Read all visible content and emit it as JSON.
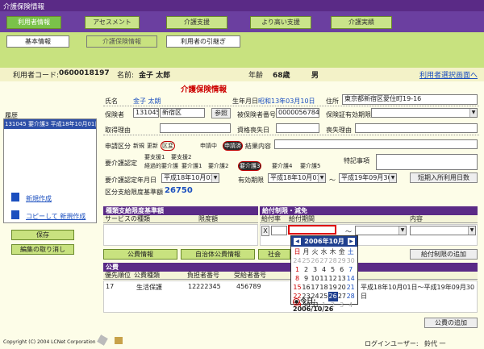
{
  "app": {
    "title": "介護保険情報"
  },
  "topnav": [
    "利用者情報",
    "アセスメント",
    "介護支援",
    "より高い支援",
    "介護実績"
  ],
  "subnav": [
    "基本情報",
    "介護保険情報",
    "利用者の引継ぎ"
  ],
  "userbar": {
    "code_label": "利用者コード:",
    "code": "0600018197",
    "name_label": "名前:",
    "name": "金子 太郎",
    "age_label": "年齢",
    "age": "68歳",
    "sex": "男",
    "link": "利用者選択画面へ"
  },
  "sidebar": {
    "history_label": "履歴",
    "history_item": "131045 要介護3 平成18年10月01日",
    "new_link": "新規作成",
    "copy_link": "コピーして 新規作成",
    "save": "保存",
    "cancel": "編集の取り消し"
  },
  "form": {
    "heading": "介護保険情報",
    "name_label": "氏名",
    "name_value": "金子 太朗",
    "dob_label": "生年月日",
    "dob_value": "昭和13年03月10日",
    "addr_label": "住所",
    "addr_value": "東京都新宿区愛住町19-16",
    "insurer_label": "保険者",
    "insurer_code": "131045",
    "insurer_name": "新宿区",
    "ref_btn": "参照",
    "insured_label": "被保険者番号",
    "insured_value": "0000056784",
    "cert_label": "保険証有効期限",
    "acq_label": "取得理由",
    "loss_label": "資格喪失日",
    "loss_reason_label": "喪失理由",
    "apply_label": "申請区分",
    "apply_opts": [
      "新規",
      "更新",
      "区変",
      "申請中",
      "申請済"
    ],
    "result_label": "結果内容",
    "level_label": "要介護認定",
    "level_row1": [
      "要支援1",
      "要支援2"
    ],
    "level_row2": [
      "経過的要介護",
      "要介護1",
      "要介護2",
      "要介護3",
      "要介護4",
      "要介護5"
    ],
    "special_label": "特記事項",
    "certdate_label": "要介護認定年月日",
    "certdate_value": "平成18年10月01日",
    "valid_label": "有効期限",
    "valid_from": "平成18年10月01日",
    "valid_sep": "～",
    "valid_to": "平成19年09月30日",
    "short_btn": "短期入所利用日数",
    "limit_label": "区分支給限度基準額",
    "limit_value": "26750"
  },
  "benefit": {
    "title": "種類支給限度基準額",
    "col_service": "サービスの種類",
    "col_limit": "限度額"
  },
  "restrict": {
    "title": "給付制限・減免",
    "col_rate": "給付率",
    "col_period": "給付期間",
    "col_content": "内容",
    "x": "X",
    "sep": "～",
    "add_btn": "給付制限の追加"
  },
  "tabs": [
    "公費情報",
    "自治体公費情報",
    "社会"
  ],
  "public": {
    "title": "公費",
    "headers": [
      "優先順位",
      "公費種類",
      "負担者番号",
      "受給者番号"
    ],
    "row": [
      "17",
      "生活保護",
      "12222345",
      "456789"
    ],
    "period": "平成18年10月01日～平成19年09月30日",
    "add_btn": "公費の追加"
  },
  "calendar": {
    "month": "2006年10月",
    "weekdays": [
      "日",
      "月",
      "火",
      "水",
      "木",
      "金",
      "土"
    ],
    "weeks": [
      [
        "24",
        "25",
        "26",
        "27",
        "28",
        "29",
        "30"
      ],
      [
        "1",
        "2",
        "3",
        "4",
        "5",
        "6",
        "7"
      ],
      [
        "8",
        "9",
        "10",
        "11",
        "12",
        "13",
        "14"
      ],
      [
        "15",
        "16",
        "17",
        "18",
        "19",
        "20",
        "21"
      ],
      [
        "22",
        "23",
        "24",
        "25",
        "26",
        "27",
        "28"
      ],
      [
        "29",
        "30",
        "31",
        "1",
        "2",
        "3",
        "4"
      ]
    ],
    "today": "今日: 2006/10/26"
  },
  "footer": {
    "copyright": "Copyright (C) 2004 LCNet Corporation",
    "login_label": "ログインユーザー:",
    "login_user": "鈴代 一"
  }
}
